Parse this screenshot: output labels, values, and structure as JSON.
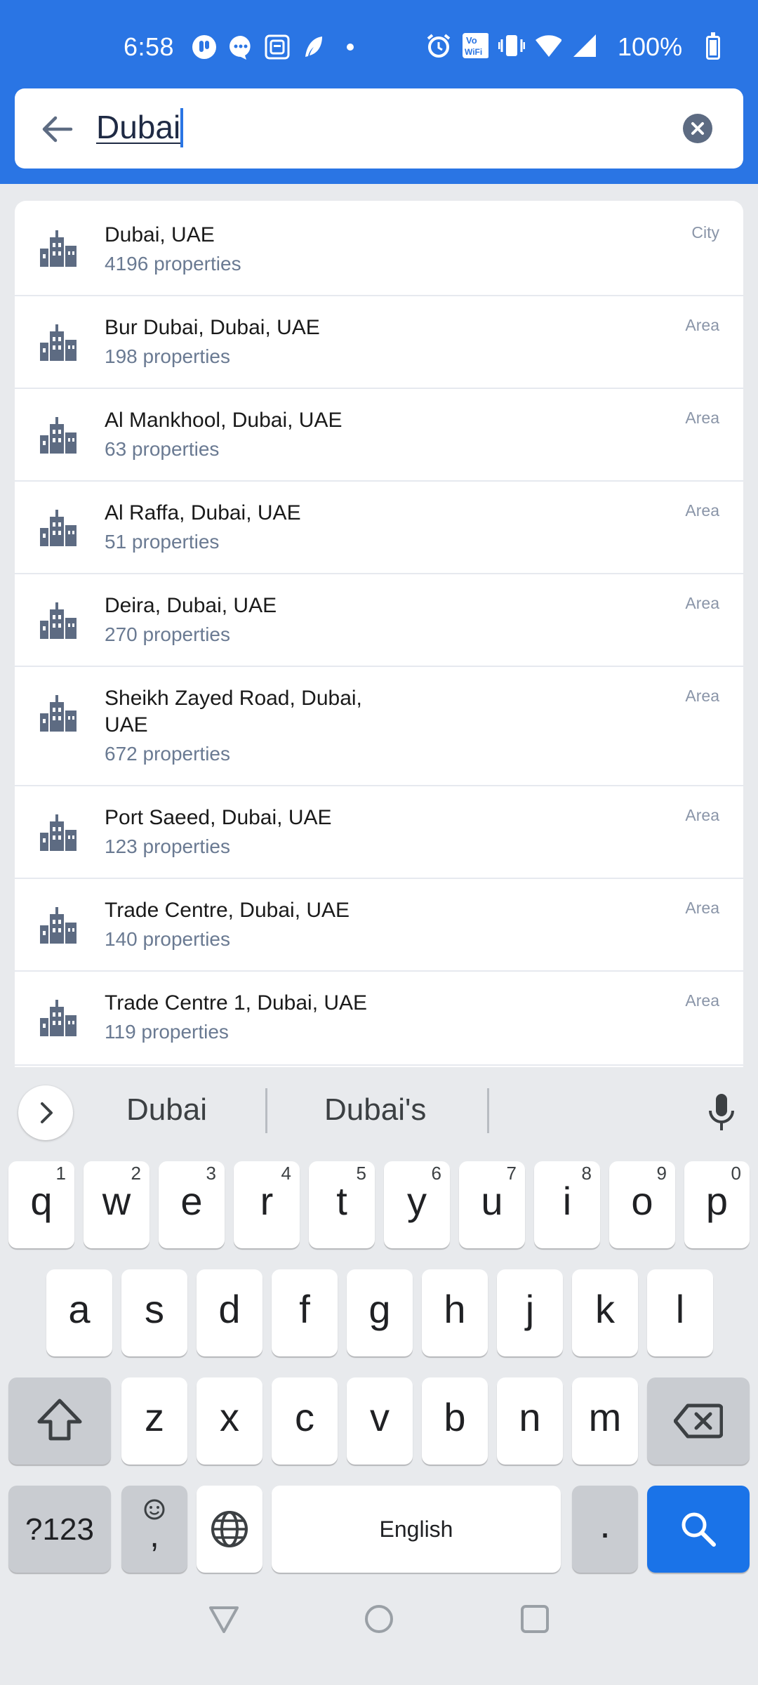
{
  "status": {
    "time": "6:58",
    "battery": "100%"
  },
  "search": {
    "query": "Dubai"
  },
  "results": [
    {
      "name": "Dubai, UAE",
      "count": "4196 properties",
      "type": "City"
    },
    {
      "name": "Bur Dubai, Dubai, UAE",
      "count": "198 properties",
      "type": "Area"
    },
    {
      "name": "Al Mankhool, Dubai, UAE",
      "count": "63 properties",
      "type": "Area"
    },
    {
      "name": "Al Raffa, Dubai, UAE",
      "count": "51 properties",
      "type": "Area"
    },
    {
      "name": "Deira, Dubai, UAE",
      "count": "270 properties",
      "type": "Area"
    },
    {
      "name": "Sheikh Zayed Road, Dubai, UAE",
      "count": "672 properties",
      "type": "Area"
    },
    {
      "name": "Port Saeed, Dubai, UAE",
      "count": "123 properties",
      "type": "Area"
    },
    {
      "name": "Trade Centre, Dubai, UAE",
      "count": "140 properties",
      "type": "Area"
    },
    {
      "name": "Trade Centre 1, Dubai, UAE",
      "count": "119 properties",
      "type": "Area"
    }
  ],
  "keyboard": {
    "suggestions": [
      "Dubai",
      "Dubai's"
    ],
    "row1": [
      "q",
      "w",
      "e",
      "r",
      "t",
      "y",
      "u",
      "i",
      "o",
      "p"
    ],
    "row1_nums": [
      "1",
      "2",
      "3",
      "4",
      "5",
      "6",
      "7",
      "8",
      "9",
      "0"
    ],
    "row2": [
      "a",
      "s",
      "d",
      "f",
      "g",
      "h",
      "j",
      "k",
      "l"
    ],
    "row3": [
      "z",
      "x",
      "c",
      "v",
      "b",
      "n",
      "m"
    ],
    "symbols_key": "?123",
    "comma_key": ",",
    "space_label": "English",
    "period_key": "."
  },
  "colors": {
    "accent": "#2a75e4",
    "icon": "#5d6b82"
  }
}
